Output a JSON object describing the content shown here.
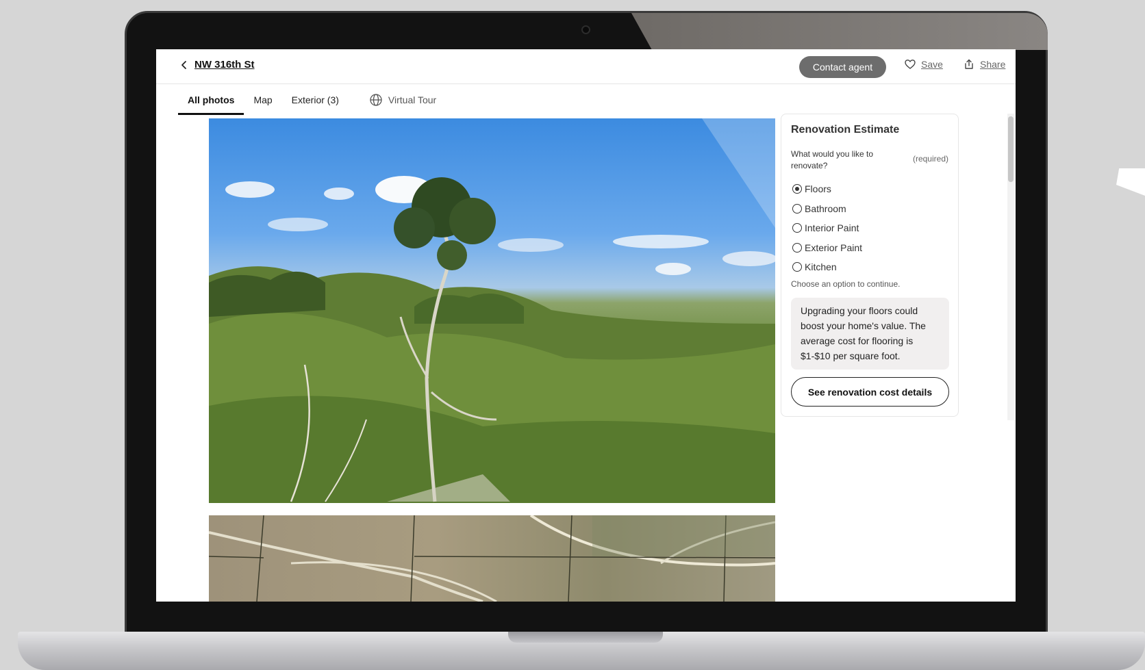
{
  "header": {
    "back_label": "NW 316th St",
    "contact_label": "Contact agent",
    "save_label": "Save",
    "share_label": "Share"
  },
  "tabs": [
    {
      "label": "All photos",
      "active": true
    },
    {
      "label": "Map",
      "active": false
    },
    {
      "label": "Exterior (3)",
      "active": false
    },
    {
      "label": "Virtual Tour",
      "active": false,
      "icon": "globe-icon"
    }
  ],
  "renovation": {
    "title": "Renovation Estimate",
    "question": "What would you like to renovate?",
    "required": "(required)",
    "options": [
      {
        "label": "Floors",
        "checked": true
      },
      {
        "label": "Bathroom",
        "checked": false
      },
      {
        "label": "Interior Paint",
        "checked": false
      },
      {
        "label": "Exterior Paint",
        "checked": false
      },
      {
        "label": "Kitchen",
        "checked": false
      }
    ],
    "hint": "Choose an option to continue.",
    "info": "Upgrading your floors could boost your home's value. The average cost for flooring is $1-$10 per square foot.",
    "button_label": "See renovation cost details"
  },
  "colors": {
    "contact_button_bg": "#6d6d6d",
    "info_box_bg": "#f1efef",
    "laptop_bezel": "#121212",
    "background": "#d6d6d6"
  }
}
